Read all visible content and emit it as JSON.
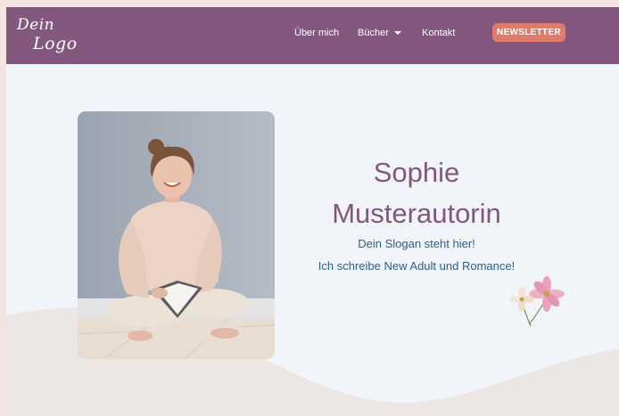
{
  "colors": {
    "header": "#84587e",
    "accent": "#e07a6a",
    "title": "#83577d",
    "slogan": "#2f5f8d",
    "background": "#f1f5f9"
  },
  "logo": {
    "line1": "Dein",
    "line2": "Logo"
  },
  "nav": {
    "items": [
      {
        "label": "Über mich",
        "has_dropdown": false
      },
      {
        "label": "Bücher",
        "has_dropdown": true
      },
      {
        "label": "Kontakt",
        "has_dropdown": false
      }
    ],
    "newsletter": "NEWSLETTER"
  },
  "hero": {
    "name_first": "Sophie",
    "name_last": "Musterautorin",
    "slogan": "Dein Slogan steht hier!",
    "tagline": "Ich schreibe New Adult und Romance!"
  }
}
